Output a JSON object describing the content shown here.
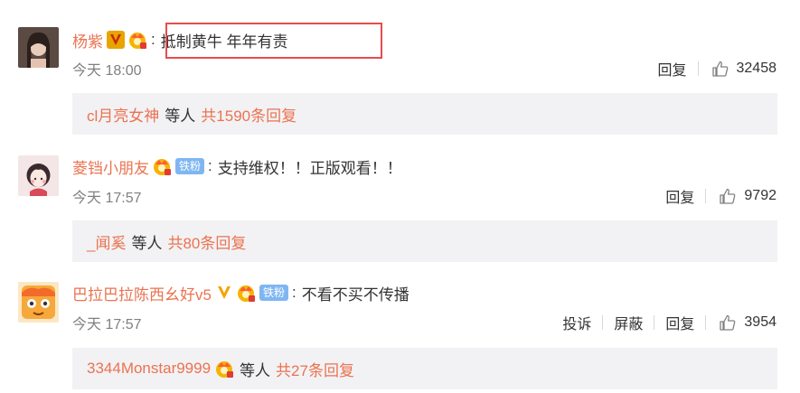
{
  "comments": [
    {
      "username": "杨紫",
      "text": "抵制黄牛 年年有责",
      "colon": ":",
      "time": "今天 18:00",
      "actions": [
        "回复"
      ],
      "likes": "32458",
      "reply_user": "cl月亮女神",
      "reply_mid": "等人",
      "reply_more": "共1590条回复"
    },
    {
      "username": "菱铛小朋友",
      "fan_badge": "铁粉",
      "text": "支持维权！！正版观看！！",
      "colon": ":",
      "time": "今天 17:57",
      "actions": [
        "回复"
      ],
      "likes": "9792",
      "reply_user": "_闻奚",
      "reply_mid": "等人",
      "reply_more": "共80条回复"
    },
    {
      "username": "巴拉巴拉陈西幺好v5",
      "fan_badge": "铁粉",
      "text": "不看不买不传播",
      "colon": ":",
      "time": "今天 17:57",
      "actions": [
        "投诉",
        "屏蔽",
        "回复"
      ],
      "likes": "3954",
      "reply_user": "3344Monstar9999",
      "reply_mid": "等人",
      "reply_more": "共27条回复"
    }
  ],
  "colors": {
    "accent": "#eb7350",
    "highlight_border": "#e94b4b",
    "fan_badge": "#7fb6f2",
    "reply_bg": "#f2f2f5"
  }
}
